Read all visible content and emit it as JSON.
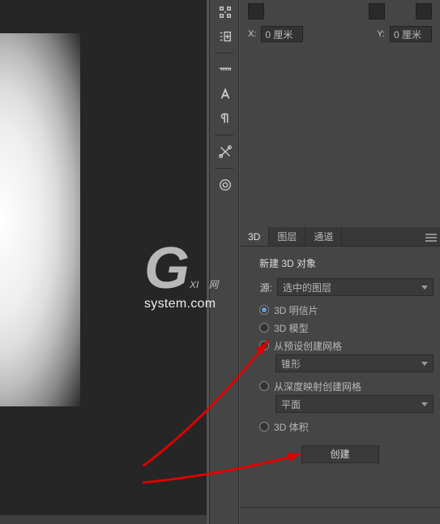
{
  "coords": {
    "x_label": "X:",
    "x_value": "0 厘米",
    "y_label": "Y:",
    "y_value": "0 厘米"
  },
  "tool_icons": [
    "distribute-icon",
    "insert-spacing-icon",
    "ruler-icon",
    "character-icon",
    "paragraph-rtl-icon",
    "ruler-short-icon",
    "tools-crossed-icon",
    "cc-icon"
  ],
  "tabs": {
    "t3d": "3D",
    "layers": "图层",
    "channels": "通道"
  },
  "panel": {
    "heading": "新建 3D 对象",
    "source_label": "源:",
    "source_value": "选中的图层",
    "radios": {
      "postcard": "3D 明信片",
      "model": "3D 模型",
      "mesh_from_preset": "从预设创建网格",
      "mesh_from_depth": "从深度映射创建网格",
      "volume": "3D 体积"
    },
    "preset_value": "锥形",
    "depth_value": "平面",
    "create": "创建"
  },
  "watermark": {
    "line1": "GXI",
    "line2": "网",
    "sub": "system.com"
  }
}
